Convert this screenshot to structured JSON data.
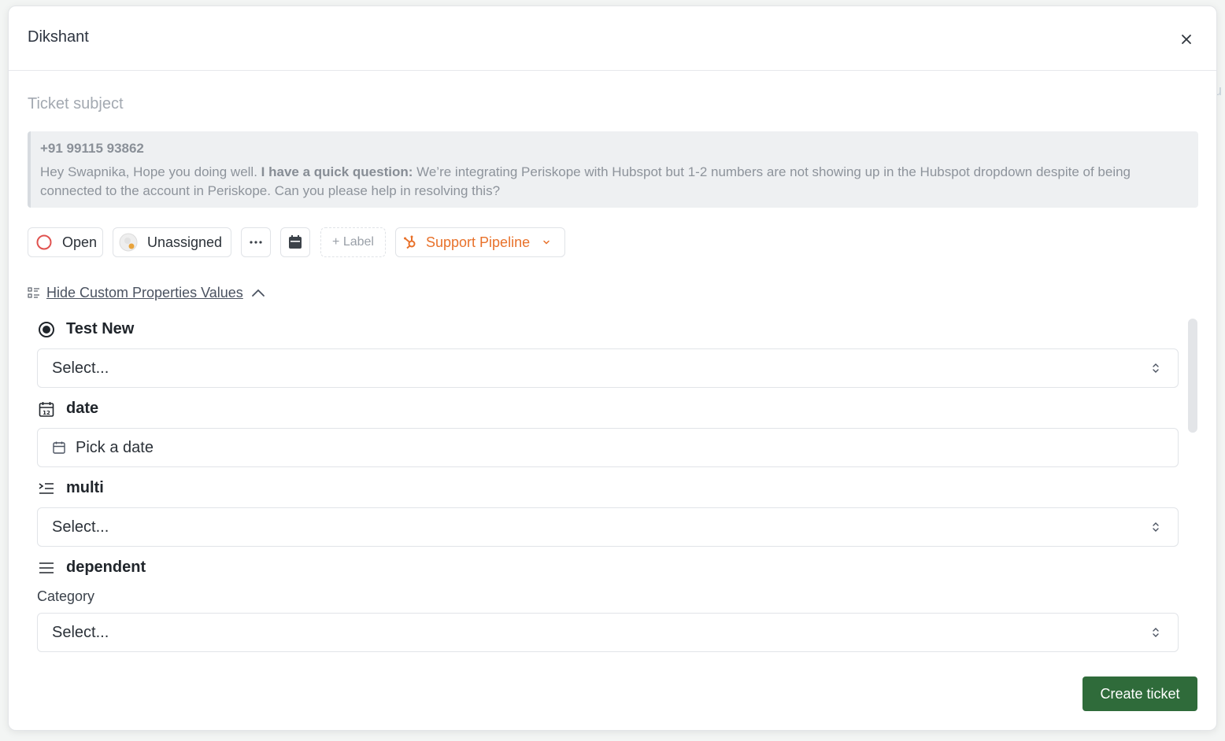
{
  "modal": {
    "title": "Dikshant"
  },
  "subject": {
    "placeholder": "Ticket subject"
  },
  "message": {
    "phone": "+91 99115 93862",
    "text_before": "Hey Swapnika, Hope you doing well. ",
    "text_bold": "I have a quick question:",
    "text_after": " We’re integrating Periskope with Hubspot but 1-2 numbers are not showing up in the Hubspot dropdown despite of being connected to the account in Periskope. Can you please help in resolving this?"
  },
  "toolbar": {
    "status_label": "Open",
    "assignee_label": "Unassigned",
    "more_icon": "ellipsis-icon",
    "date_icon": "calendar-icon",
    "label_button": "+ Label",
    "pipeline_label": "Support Pipeline",
    "pipeline_icon": "hubspot-icon"
  },
  "custom_props": {
    "toggle_label": "Hide Custom Properties Values",
    "fields": [
      {
        "name": "Test New",
        "icon": "radio-icon",
        "placeholder": "Select..."
      },
      {
        "name": "date",
        "icon": "calendar-12-icon",
        "placeholder": "Pick a date"
      },
      {
        "name": "multi",
        "icon": "list-indent-icon",
        "placeholder": "Select..."
      },
      {
        "name": "dependent",
        "icon": "menu-lines-icon",
        "sub_label": "Category",
        "placeholder": "Select..."
      }
    ]
  },
  "footer": {
    "create_label": "Create ticket"
  },
  "colors": {
    "accent_green": "#2f6b3a",
    "pipeline_orange": "#e8712a",
    "status_red": "#e0524f"
  }
}
